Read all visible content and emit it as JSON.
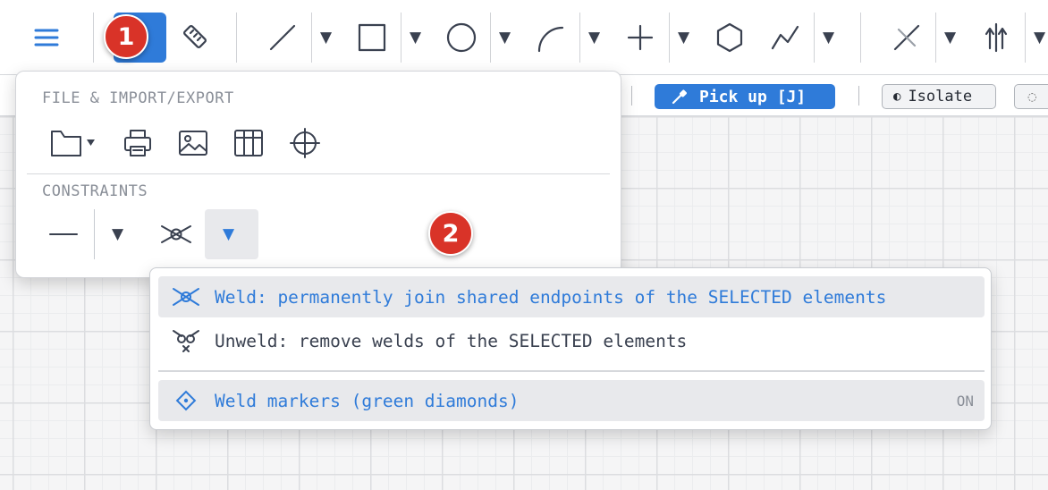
{
  "toolbar": {
    "tools": [
      {
        "name": "menu",
        "icon": "hamburger-icon"
      },
      {
        "name": "active-tool",
        "icon": "highlighted-tool"
      },
      {
        "name": "measure",
        "icon": "ruler-icon"
      },
      {
        "name": "line",
        "icon": "line-icon",
        "has_dropdown": true
      },
      {
        "name": "rectangle",
        "icon": "rectangle-icon",
        "has_dropdown": true
      },
      {
        "name": "circle",
        "icon": "circle-icon",
        "has_dropdown": true
      },
      {
        "name": "arc",
        "icon": "arc-icon",
        "has_dropdown": true
      },
      {
        "name": "point",
        "icon": "plus-icon",
        "has_dropdown": true
      },
      {
        "name": "polygon",
        "icon": "hexagon-icon"
      },
      {
        "name": "polyline",
        "icon": "polyline-icon",
        "has_dropdown": true
      },
      {
        "name": "trim",
        "icon": "trim-icon",
        "has_dropdown": true
      },
      {
        "name": "mirror",
        "icon": "mirror-icon",
        "has_dropdown": true
      }
    ],
    "dropdown_glyph": "▼"
  },
  "secondary_bar": {
    "pickup_label": "Pick up [J]",
    "pickup_icon": "eyedropper-icon",
    "isolate_label": "Isolate",
    "isolate_glyph": "◐",
    "extra_glyph": "◌"
  },
  "main_menu": {
    "file_section_title": "FILE & IMPORT/EXPORT",
    "file_icons": [
      "folder-icon",
      "print-icon",
      "image-icon",
      "table-icon",
      "crosshair-icon"
    ],
    "constraints_section_title": "CONSTRAINTS",
    "constraint_icons": [
      "horizontal-constraint-icon",
      "weld-icon"
    ],
    "dropdown_glyph": "▼"
  },
  "weld_dropdown": {
    "items": [
      {
        "label": "Weld: permanently join shared endpoints of the SELECTED elements",
        "icon": "weld-icon",
        "highlighted": true
      },
      {
        "label": "Unweld: remove welds of the SELECTED elements",
        "icon": "unweld-icon",
        "highlighted": false
      }
    ],
    "markers": {
      "label": "Weld markers (green diamonds)",
      "icon": "diamond-icon",
      "status": "ON"
    }
  },
  "badges": [
    "1",
    "2"
  ],
  "colors": {
    "accent": "#2f7bd9",
    "badge": "#d93328",
    "icon": "#3a4150"
  }
}
